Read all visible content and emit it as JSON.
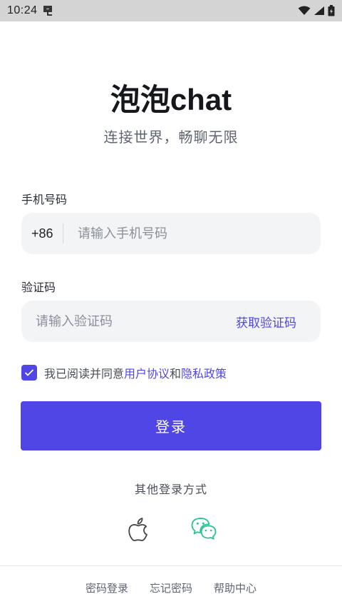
{
  "status_bar": {
    "time": "10:24",
    "icons": [
      "bug-icon",
      "wifi-icon",
      "signal-icon",
      "battery-icon"
    ]
  },
  "app": {
    "title": "泡泡chat",
    "subtitle": "连接世界，畅聊无限"
  },
  "form": {
    "phone_label": "手机号码",
    "country_code": "+86",
    "phone_placeholder": "请输入手机号码",
    "code_label": "验证码",
    "code_placeholder": "请输入验证码",
    "get_code_label": "获取验证码"
  },
  "agreement": {
    "checked": true,
    "prefix": "我已阅读并同意",
    "terms_link": "用户协议",
    "and": "和",
    "privacy_link": "隐私政策"
  },
  "login_button_label": "登录",
  "other_login": {
    "label": "其他登录方式",
    "providers": [
      "apple-icon",
      "wechat-icon"
    ]
  },
  "footer": {
    "password_login": "密码登录",
    "forgot_password": "忘记密码",
    "help_center": "帮助中心"
  },
  "colors": {
    "primary": "#5046e6",
    "link": "#4f46e5",
    "input_bg": "#f3f4f6",
    "wechat": "#2bc28d",
    "apple": "#444444",
    "status_bar_bg": "#d4d4d4"
  }
}
